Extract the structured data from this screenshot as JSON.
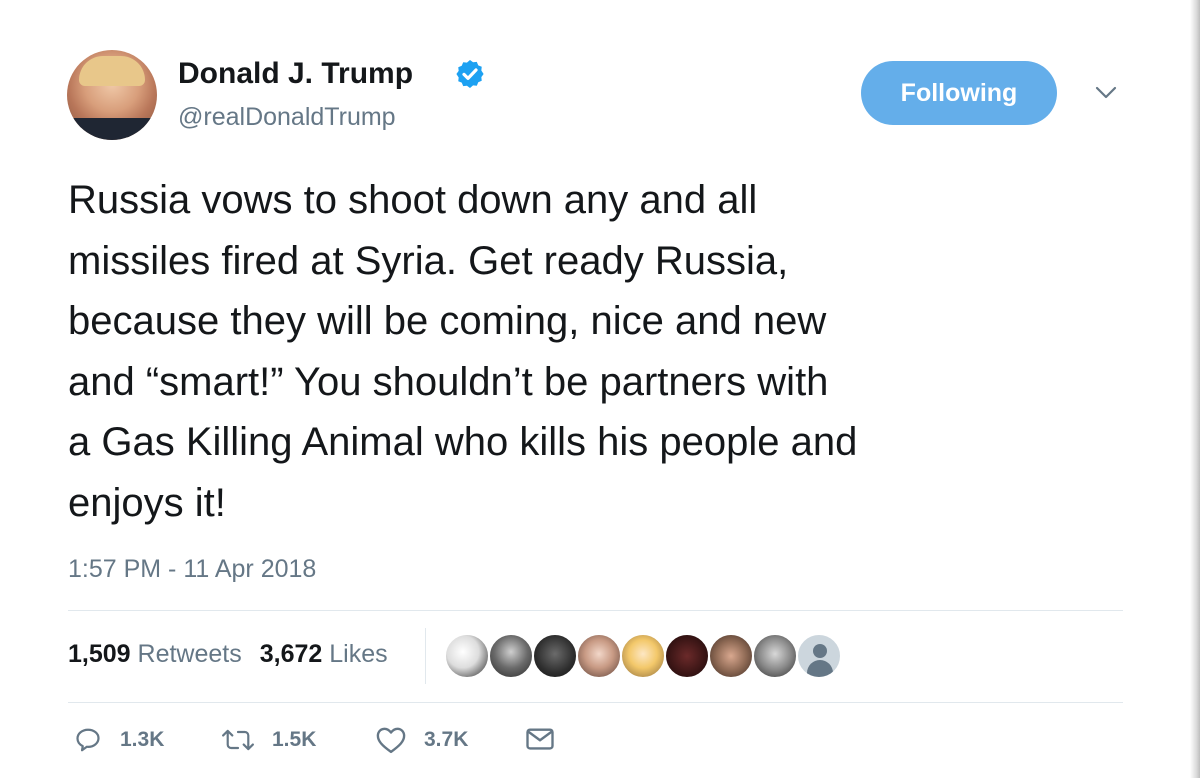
{
  "user": {
    "name": "Donald J. Trump",
    "handle": "@realDonaldTrump",
    "verified": true
  },
  "follow_button": {
    "label": "Following",
    "color": "#64aeea"
  },
  "tweet": {
    "lines": [
      "Russia vows to shoot down any and all",
      "missiles fired at Syria. Get ready Russia,",
      "because they will be coming, nice and new",
      "and “smart!” You shouldn’t be partners with",
      "a Gas Killing Animal who kills his people and",
      "enjoys it!"
    ],
    "timestamp": "1:57 PM - 11 Apr 2018"
  },
  "stats": {
    "retweets_count": "1,509",
    "retweets_label": "Retweets",
    "likes_count": "3,672",
    "likes_label": "Likes"
  },
  "actions": {
    "reply_count": "1.3K",
    "retweet_count": "1.5K",
    "like_count": "3.7K"
  },
  "icons": {
    "verified": "verified-badge-icon",
    "chevron": "chevron-down-icon",
    "reply": "reply-icon",
    "retweet": "retweet-icon",
    "like": "heart-icon",
    "dm": "envelope-icon"
  },
  "colors": {
    "accent": "#1da1f2",
    "secondary_text": "#657786",
    "primary_text": "#14171a"
  }
}
